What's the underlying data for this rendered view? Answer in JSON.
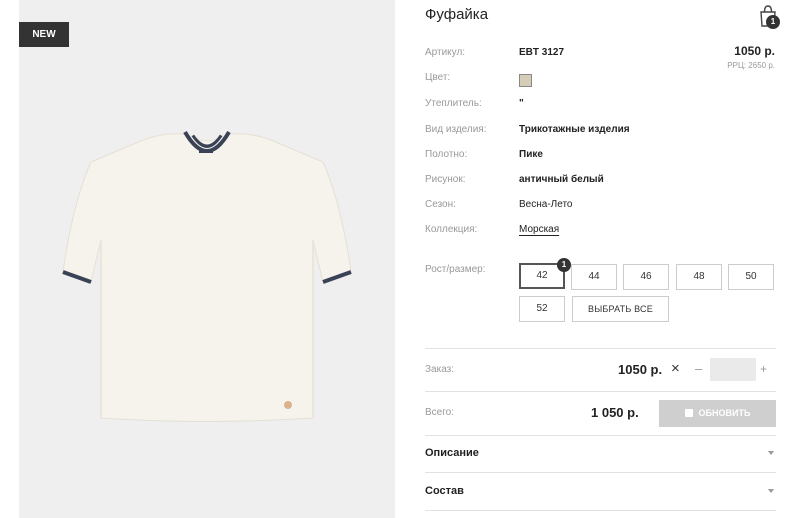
{
  "badge": {
    "new": "NEW"
  },
  "product": {
    "title": "Фуфайка",
    "price": "1050 р.",
    "rrp": "РРЦ: 2650 р."
  },
  "cart": {
    "count": "1"
  },
  "attributes": [
    {
      "label": "Артикул:",
      "value": "EBT 3127"
    },
    {
      "label": "Цвет:",
      "value": ""
    },
    {
      "label": "Утеплитель:",
      "value": "\""
    },
    {
      "label": "Вид изделия:",
      "value": "Трикотажные изделия"
    },
    {
      "label": "Полотно:",
      "value": "Пике"
    },
    {
      "label": "Рисунок:",
      "value": "античный белый"
    },
    {
      "label": "Сезон:",
      "value": "Весна-Лето"
    },
    {
      "label": "Коллекция:",
      "value": "Морская"
    }
  ],
  "sizes": {
    "label": "Рост/размер:",
    "options": [
      "42",
      "44",
      "46",
      "48",
      "50",
      "52"
    ],
    "selected": "42",
    "selected_count": "1",
    "select_all": "ВЫБРАТЬ ВСЕ"
  },
  "order": {
    "label": "Заказ:",
    "price": "1050 р.",
    "times": "×",
    "minus": "–",
    "plus": "+",
    "qty": ""
  },
  "total": {
    "label": "Всего:",
    "value": "1 050 р.",
    "update_button": "ОБНОВИТЬ"
  },
  "accordion": {
    "description": "Описание",
    "composition": "Состав"
  },
  "colors": {
    "swatch": "#d6cdb8",
    "badge_bg": "#333333"
  }
}
